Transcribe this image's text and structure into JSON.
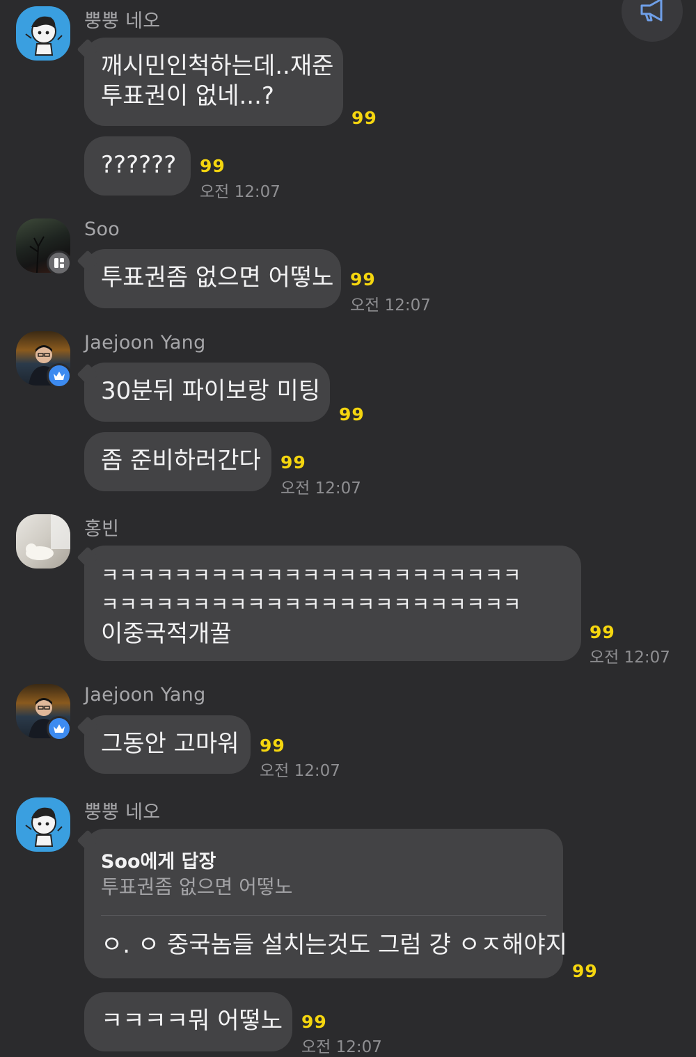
{
  "colors": {
    "background": "#2b2b2d",
    "bubble": "#434345",
    "unread_count": "#f5d60f",
    "timestamp": "#8f8f92",
    "sender_name": "#a6a6a9",
    "badge_blue": "#3d8bf0"
  },
  "header": {
    "notice_icon": "megaphone-icon"
  },
  "messages": {
    "m1": {
      "sender": "뿡뿡 네오",
      "bubble1_line1": "깨시민인척하는데..재준",
      "bubble1_line2": "투표권이 없네...?",
      "bubble1_count": "99",
      "bubble2": "??????",
      "bubble2_count": "99",
      "time": "오전 12:07"
    },
    "m2": {
      "sender": "Soo",
      "badge_icon": "manager-badge-icon",
      "bubble1": "투표권좀 없으면 어떻노",
      "bubble1_count": "99",
      "time": "오전 12:07"
    },
    "m3": {
      "sender": "Jaejoon Yang",
      "badge_icon": "crown-icon",
      "bubble1": "30분뒤 파이보랑 미팅",
      "bubble1_count": "99",
      "bubble2": "좀 준비하러간다",
      "bubble2_count": "99",
      "time": "오전 12:07"
    },
    "m4": {
      "sender": "홍빈",
      "bubble1_line1": "ㅋㅋㅋㅋㅋㅋㅋㅋㅋㅋㅋㅋㅋㅋㅋㅋㅋㅋㅋㅋㅋㅋㅋ",
      "bubble1_line2": "ㅋㅋㅋㅋㅋㅋㅋㅋㅋㅋㅋㅋㅋㅋㅋㅋㅋㅋㅋㅋㅋㅋㅋ",
      "bubble1_line3": "이중국적개꿀",
      "bubble1_count": "99",
      "time": "오전 12:07"
    },
    "m5": {
      "sender": "Jaejoon Yang",
      "badge_icon": "crown-icon",
      "bubble1": "그동안 고마워",
      "bubble1_count": "99",
      "time": "오전 12:07"
    },
    "m6": {
      "sender": "뿡뿡 네오",
      "reply_label": "Soo에게 답장",
      "reply_quote": "투표권좀 없으면 어떻노",
      "reply_text": "ㅇ. ㅇ 중국놈들 설치는것도 그럼 걍 ㅇㅈ해야지",
      "bubble1_count": "99",
      "bubble2": "ㅋㅋㅋㅋ뭐 어떻노",
      "bubble2_count": "99",
      "time": "오전 12:07"
    }
  }
}
